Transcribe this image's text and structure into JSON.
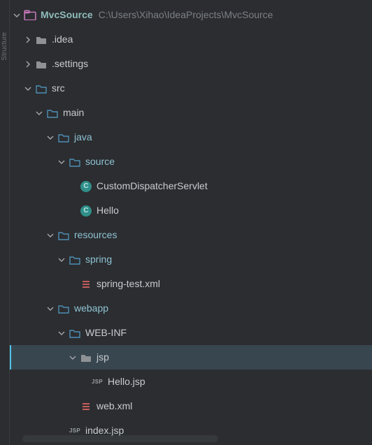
{
  "project": {
    "name": "MvcSource",
    "path": "C:\\Users\\Xihao\\IdeaProjects\\MvcSource"
  },
  "gutter": {
    "structure_label": "Structure"
  },
  "tree": [
    {
      "id": "idea",
      "depth": 1,
      "expand": "collapsed",
      "icon": "folder-grey",
      "label": ".idea"
    },
    {
      "id": "settings",
      "depth": 1,
      "expand": "collapsed",
      "icon": "folder-grey",
      "label": ".settings"
    },
    {
      "id": "src",
      "depth": 1,
      "expand": "expanded",
      "icon": "folder-blue",
      "label": "src"
    },
    {
      "id": "main",
      "depth": 2,
      "expand": "expanded",
      "icon": "folder-blue",
      "label": "main"
    },
    {
      "id": "java",
      "depth": 3,
      "expand": "expanded",
      "icon": "folder-blue",
      "label": "java",
      "src": true
    },
    {
      "id": "source",
      "depth": 4,
      "expand": "expanded",
      "icon": "folder-blue",
      "label": "source",
      "src": true
    },
    {
      "id": "cds",
      "depth": 5,
      "expand": "none",
      "icon": "class",
      "label": "CustomDispatcherServlet"
    },
    {
      "id": "hello",
      "depth": 5,
      "expand": "none",
      "icon": "class",
      "label": "Hello"
    },
    {
      "id": "resources",
      "depth": 3,
      "expand": "expanded",
      "icon": "folder-blue",
      "label": "resources",
      "src": true
    },
    {
      "id": "spring",
      "depth": 4,
      "expand": "expanded",
      "icon": "folder-blue",
      "label": "spring",
      "src": true
    },
    {
      "id": "springtest",
      "depth": 5,
      "expand": "none",
      "icon": "xml",
      "label": "spring-test.xml"
    },
    {
      "id": "webapp",
      "depth": 3,
      "expand": "expanded",
      "icon": "folder-blue",
      "label": "webapp",
      "src": true
    },
    {
      "id": "webinf",
      "depth": 4,
      "expand": "expanded",
      "icon": "folder-blue",
      "label": "WEB-INF"
    },
    {
      "id": "jsp",
      "depth": 5,
      "expand": "expanded",
      "icon": "folder-grey",
      "label": "jsp",
      "selected": true
    },
    {
      "id": "hellojsp",
      "depth": 6,
      "expand": "none",
      "icon": "jsp",
      "label": "Hello.jsp"
    },
    {
      "id": "webxml",
      "depth": 5,
      "expand": "none",
      "icon": "xml",
      "label": "web.xml"
    },
    {
      "id": "indexjsp",
      "depth": 4,
      "expand": "none",
      "icon": "jsp",
      "label": "index.jsp"
    }
  ],
  "colors": {
    "folder_blue": "#4e8eb5",
    "folder_grey": "#8e9295",
    "project_pink": "#c678bc"
  }
}
